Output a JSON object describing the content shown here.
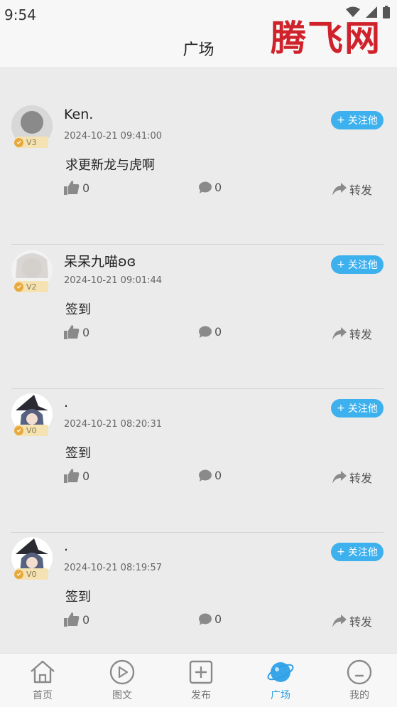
{
  "status_bar": {
    "time": "9:54"
  },
  "header": {
    "title": "广场",
    "watermark": "腾飞网"
  },
  "posts": [
    {
      "username": "Ken.",
      "time": "2024-10-21 09:41:00",
      "content": "求更新龙与虎啊",
      "level": "V3",
      "follow_label": "关注他",
      "likes": "0",
      "comments": "0",
      "share_label": "转发"
    },
    {
      "username": "呆呆九喵ʚɞ",
      "time": "2024-10-21 09:01:44",
      "content": "签到",
      "level": "V2",
      "follow_label": "关注他",
      "likes": "0",
      "comments": "0",
      "share_label": "转发"
    },
    {
      "username": ".",
      "time": "2024-10-21 08:20:31",
      "content": "签到",
      "level": "V0",
      "follow_label": "关注他",
      "likes": "0",
      "comments": "0",
      "share_label": "转发"
    },
    {
      "username": ".",
      "time": "2024-10-21 08:19:57",
      "content": "签到",
      "level": "V0",
      "follow_label": "关注他",
      "likes": "0",
      "comments": "0",
      "share_label": "转发"
    }
  ],
  "tabbar": {
    "items": [
      {
        "label": "首页",
        "icon": "home-icon"
      },
      {
        "label": "图文",
        "icon": "play-icon"
      },
      {
        "label": "发布",
        "icon": "plus-square-icon"
      },
      {
        "label": "广场",
        "icon": "planet-icon",
        "active": true
      },
      {
        "label": "我的",
        "icon": "profile-face-icon"
      }
    ]
  },
  "colors": {
    "accent": "#2f9fe3",
    "follow_bg": "#3db0ee",
    "watermark": "#d0222b",
    "feed_bg": "#ebebeb"
  }
}
